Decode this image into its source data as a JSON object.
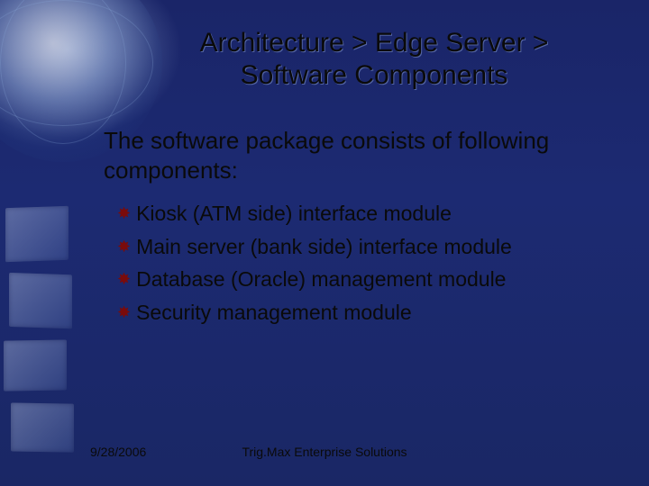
{
  "title": "Architecture > Edge Server > Software Components",
  "intro": "The software package consists of following components:",
  "bullets": [
    "Kiosk (ATM side) interface module",
    "Main server (bank side) interface module",
    "Database (Oracle) management module",
    "Security management module"
  ],
  "footer": {
    "date": "9/28/2006",
    "org": "Trig.Max Enterprise Solutions"
  }
}
